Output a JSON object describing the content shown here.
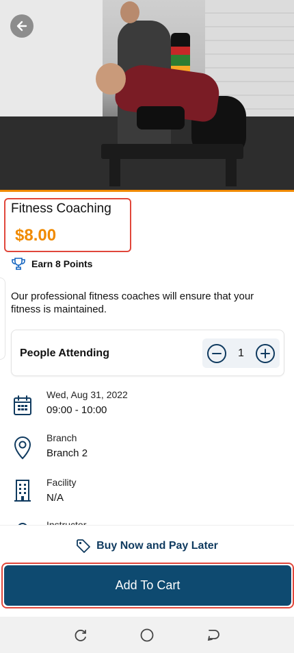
{
  "product": {
    "title": "Fitness Coaching",
    "price": "$8.00",
    "points_label": "Earn 8 Points",
    "description": "Our professional fitness coaches will ensure that your fitness is maintained."
  },
  "attendance": {
    "label": "People Attending",
    "count": "1"
  },
  "details": {
    "date": "Wed, Aug 31, 2022",
    "time": "09:00 - 10:00",
    "branch_label": "Branch",
    "branch_value": "Branch 2",
    "facility_label": "Facility",
    "facility_value": "N/A",
    "instructor_label": "Instructor"
  },
  "actions": {
    "pay_later": "Buy Now and Pay Later",
    "add_to_cart": "Add To Cart"
  },
  "colors": {
    "accent_orange": "#f08a00",
    "primary_blue": "#0e4a70",
    "highlight_red": "#e0463a"
  },
  "icons": {
    "back": "back-arrow-icon",
    "trophy": "trophy-icon",
    "minus": "minus-circle-icon",
    "plus": "plus-circle-icon",
    "calendar": "calendar-icon",
    "location": "location-pin-icon",
    "building": "building-icon",
    "instructor": "person-icon",
    "tag": "tag-icon"
  }
}
